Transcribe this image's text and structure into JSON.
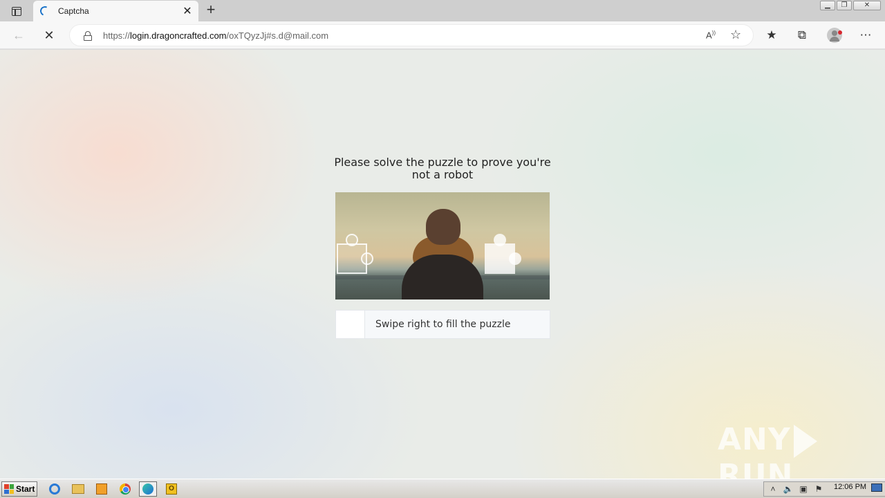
{
  "browser": {
    "tab": {
      "title": "Captcha",
      "close_label": "✕"
    },
    "new_tab_label": "+",
    "window_controls": {
      "minimize": "▁",
      "restore": "❐",
      "close": "✕"
    },
    "address": {
      "prefix": "https://",
      "host": "login.dragoncrafted.com",
      "path": "/oxTQyzJj#s.d@mail.com"
    },
    "read_aloud_label": "A",
    "icons": [
      "tab-actions-icon",
      "back-arrow-icon",
      "stop-loading-icon",
      "lock-icon",
      "read-aloud-icon",
      "add-favorite-icon",
      "favorites-icon",
      "collections-icon",
      "profile-icon",
      "more-icon"
    ]
  },
  "captcha": {
    "title": "Please solve the puzzle to prove you're not a robot",
    "slider_label": "Swipe right to fill the puzzle"
  },
  "watermark": {
    "left": "ANY",
    "right": "RUN"
  },
  "taskbar": {
    "start_label": "Start",
    "outlook_letter": "O",
    "clock": "12:06 PM",
    "apps": [
      "ie-icon",
      "folder-icon",
      "media-player-icon",
      "chrome-icon",
      "edge-icon",
      "outlook-icon"
    ],
    "tray_icons": [
      "chevron-up-icon",
      "volume-icon",
      "network-icon",
      "flag-icon"
    ]
  }
}
